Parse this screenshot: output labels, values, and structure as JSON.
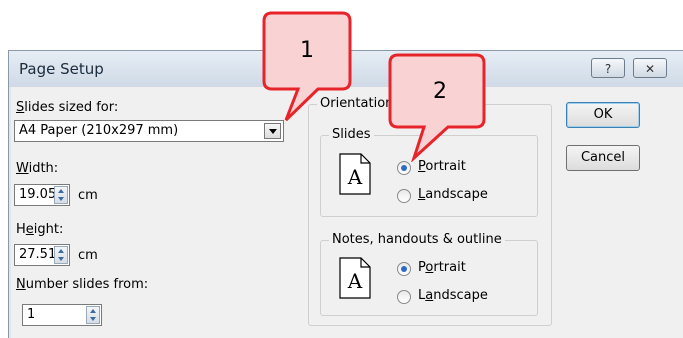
{
  "dialog": {
    "title": "Page Setup",
    "help_button": "?",
    "close_button": "✕"
  },
  "slides_sized_for": {
    "label_accel": "S",
    "label_rest": "lides sized for:",
    "value": "A4 Paper (210x297 mm)"
  },
  "width": {
    "label_accel": "W",
    "label_rest": "idth:",
    "value": "19.05",
    "unit": "cm"
  },
  "height": {
    "label_pre": "H",
    "label_accel": "e",
    "label_rest": "ight:",
    "value": "27.51",
    "unit": "cm"
  },
  "number_from": {
    "label_accel": "N",
    "label_rest": "umber slides from:",
    "value": "1"
  },
  "orientation": {
    "label": "Orientation",
    "slides": {
      "label": "Slides",
      "portrait_accel": "P",
      "portrait_rest": "ortrait",
      "landscape_accel": "L",
      "landscape_rest": "andscape",
      "selected": "Portrait"
    },
    "notes": {
      "label": "Notes, handouts & outline",
      "portrait_pre": "P",
      "portrait_accel": "o",
      "portrait_rest": "rtrait",
      "landscape_pre": "L",
      "landscape_accel": "a",
      "landscape_rest": "ndscape",
      "selected": "Portrait"
    }
  },
  "buttons": {
    "ok": "OK",
    "cancel": "Cancel"
  },
  "callouts": [
    {
      "number": "1"
    },
    {
      "number": "2"
    }
  ],
  "colors": {
    "callout_fill": "#f9d3d3",
    "callout_border": "#e8242b",
    "accent": "#2d6bc4"
  }
}
